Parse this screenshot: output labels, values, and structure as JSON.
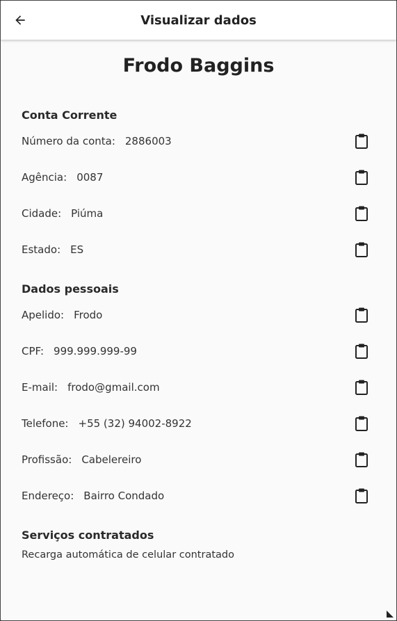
{
  "header": {
    "title": "Visualizar dados"
  },
  "profile": {
    "name": "Frodo Baggins"
  },
  "account": {
    "title": "Conta Corrente",
    "rows": [
      {
        "label": "Número da conta:",
        "value": "2886003"
      },
      {
        "label": "Agência:",
        "value": "0087"
      },
      {
        "label": "Cidade:",
        "value": "Piúma"
      },
      {
        "label": "Estado:",
        "value": "ES"
      }
    ]
  },
  "personal": {
    "title": "Dados pessoais",
    "rows": [
      {
        "label": "Apelido:",
        "value": "Frodo"
      },
      {
        "label": "CPF:",
        "value": "999.999.999-99"
      },
      {
        "label": "E-mail:",
        "value": "frodo@gmail.com"
      },
      {
        "label": "Telefone:",
        "value": "+55 (32) 94002-8922"
      },
      {
        "label": "Profissão:",
        "value": "Cabelereiro"
      },
      {
        "label": "Endereço:",
        "value": "Bairro Condado"
      }
    ]
  },
  "services": {
    "title": "Serviços contratados",
    "text": "Recarga automática de celular contratado"
  },
  "icons": {
    "back": "arrow-left-icon",
    "copy": "clipboard-icon"
  }
}
